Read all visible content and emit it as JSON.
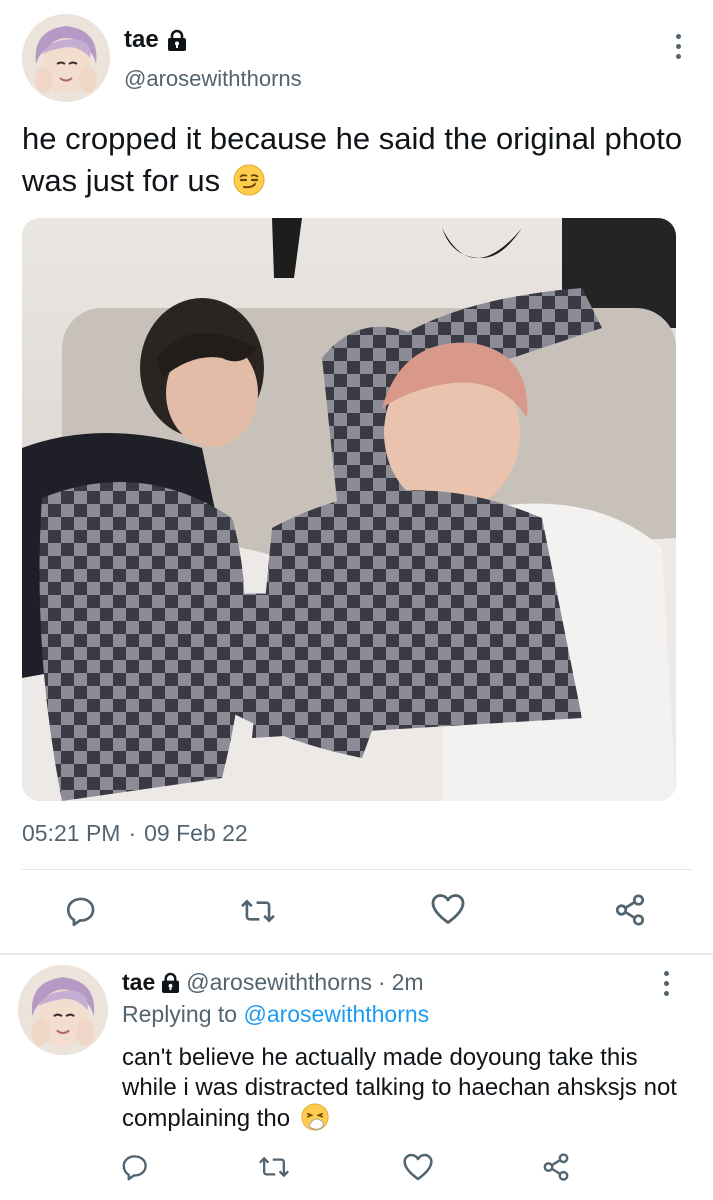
{
  "tweet": {
    "author": {
      "display_name": "tae",
      "handle": "@arosewiththorns",
      "lock_icon": "lock-icon",
      "avatar": "profile-photo"
    },
    "text": "he cropped it because he said the original photo was just for us",
    "text_emoji": "smirking-face-emoji",
    "media": "photo of two people in checkered pajamas on a couch",
    "time": "05:21 PM",
    "dot": "·",
    "date": "09 Feb 22",
    "actions": {
      "reply_icon": "reply-icon",
      "retweet_icon": "retweet-icon",
      "like_icon": "heart-icon",
      "share_icon": "share-icon"
    }
  },
  "reply": {
    "author": {
      "display_name": "tae",
      "handle": "@arosewiththorns",
      "time_sep": "·",
      "time_ago": "2m"
    },
    "replying_label": "Replying to",
    "replying_to": "@arosewiththorns",
    "text": "can't believe he actually made doyoung take this while i was distracted talking to haechan ahsksjs not complaining tho",
    "text_emoji": "sneezing-face-emoji"
  },
  "colors": {
    "text": "#0f1419",
    "secondary": "#536471",
    "accent": "#1d9bf0",
    "divider": "#e3e7ea"
  }
}
